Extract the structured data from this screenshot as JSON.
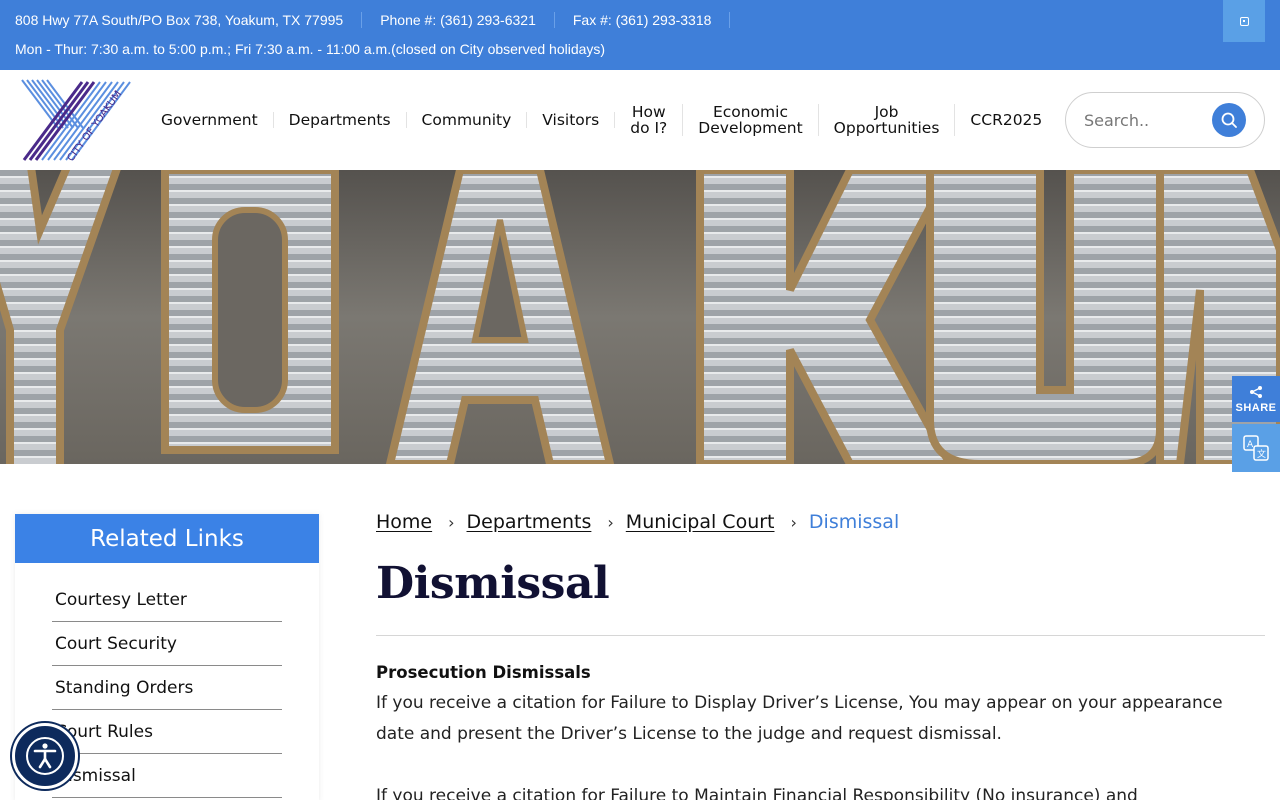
{
  "topbar": {
    "address": "808 Hwy 77A South/PO Box 738, Yoakum, TX 77995",
    "phone": "Phone #: (361) 293-6321",
    "fax": "Fax #: (361) 293-3318",
    "hours": "Mon - Thur:  7:30 a.m. to 5:00 p.m.; Fri 7:30 a.m. - 11:00 a.m.(closed on City observed holidays)"
  },
  "logo": {
    "text": "CITY OF YOAKUM"
  },
  "nav": {
    "items": [
      {
        "label": "Government"
      },
      {
        "label": "Departments"
      },
      {
        "label": "Community"
      },
      {
        "label": "Visitors"
      },
      {
        "label": "How do I?",
        "line1": "How",
        "line2": "do I?"
      },
      {
        "label": "Economic Development",
        "line1": "Economic",
        "line2": "Development"
      },
      {
        "label": "Job Opportunities",
        "line1": "Job",
        "line2": "Opportunities"
      },
      {
        "label": "CCR2025"
      }
    ]
  },
  "search": {
    "placeholder": "Search.."
  },
  "hero": {
    "letters": "YOAKUM"
  },
  "widgets": {
    "share_label": "SHARE"
  },
  "sidebar": {
    "title": "Related Links",
    "items": [
      {
        "label": "Courtesy Letter"
      },
      {
        "label": "Court Security"
      },
      {
        "label": "Standing Orders"
      },
      {
        "label": "Court Rules"
      },
      {
        "label": "Dismissal"
      }
    ]
  },
  "breadcrumb": {
    "items": [
      {
        "label": "Home"
      },
      {
        "label": "Departments"
      },
      {
        "label": "Municipal Court"
      }
    ],
    "current": "Dismissal"
  },
  "page": {
    "title": "Dismissal",
    "section_heading": "Prosecution Dismissals",
    "paragraph1": "If you receive a citation for Failure to Display Driver’s License, You may appear on your appearance date and present the Driver’s License to the judge and request dismissal.",
    "paragraph2": "If you receive a citation for Failure to Maintain Financial Responsibility (No insurance) and"
  },
  "colors": {
    "accent": "#3f7fd9",
    "sidebar_header": "#3b82e6",
    "title": "#111133",
    "logo_purple": "#4a2a8a"
  }
}
